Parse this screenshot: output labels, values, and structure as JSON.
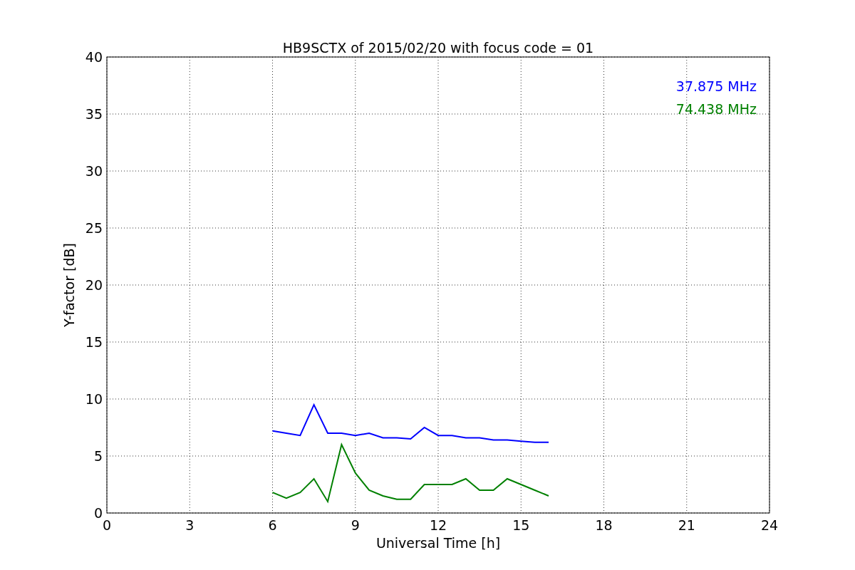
{
  "figure": {
    "chart_data": {
      "type": "line",
      "title": "HB9SCTX of 2015/02/20 with focus code = 01",
      "xlabel": "Universal Time [h]",
      "ylabel": "Y-factor [dB]",
      "x": [
        6,
        6.5,
        7,
        7.5,
        8,
        8.5,
        9,
        9.5,
        10,
        10.5,
        11,
        11.5,
        12,
        12.5,
        13,
        13.5,
        14,
        14.5,
        15,
        15.5,
        16
      ],
      "series": [
        {
          "name": "37.875 MHz",
          "color": "#0000ff",
          "values": [
            7.2,
            7.0,
            6.8,
            9.5,
            7.0,
            7.0,
            6.8,
            7.0,
            6.6,
            6.6,
            6.5,
            7.5,
            6.8,
            6.8,
            6.6,
            6.6,
            6.4,
            6.4,
            6.3,
            6.2,
            6.2
          ]
        },
        {
          "name": "74.438 MHz",
          "color": "#008000",
          "values": [
            1.8,
            1.3,
            1.8,
            3.0,
            1.0,
            6.0,
            3.5,
            2.0,
            1.5,
            1.2,
            1.2,
            2.5,
            2.5,
            2.5,
            3.0,
            2.0,
            2.0,
            3.0,
            2.5,
            2.0,
            1.5
          ]
        }
      ],
      "xlim": [
        0,
        24
      ],
      "ylim": [
        0,
        40
      ],
      "xticks": [
        0,
        3,
        6,
        9,
        12,
        15,
        18,
        21,
        24
      ],
      "yticks": [
        0,
        5,
        10,
        15,
        20,
        25,
        30,
        35,
        40
      ],
      "grid": true
    }
  }
}
